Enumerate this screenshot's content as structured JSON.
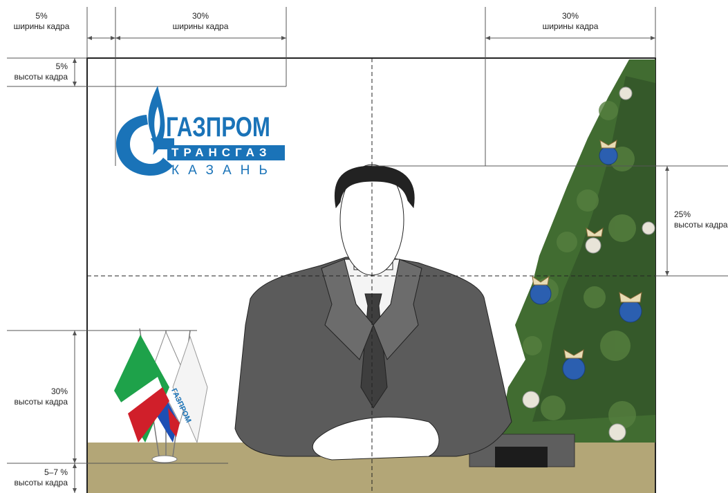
{
  "annotations": {
    "left_margin_width": [
      "5%",
      "ширины кадра"
    ],
    "logo_width": [
      "30%",
      "ширины кадра"
    ],
    "tree_width": [
      "30%",
      "ширины кадра"
    ],
    "top_margin_height": [
      "5%",
      "высоты кадра"
    ],
    "head_height": [
      "25%",
      "высоты кадра"
    ],
    "flags_height": [
      "30%",
      "высоты кадра"
    ],
    "table_height": [
      "5–7 %",
      "высоты кадра"
    ]
  },
  "logo": {
    "line1": "ГАЗПРОМ",
    "line2": "ТРАНСГАЗ",
    "line3": "КАЗАНЬ"
  },
  "flag_logo_text": "ГАЗПРОМ",
  "colors": {
    "brand_blue": "#1a73b8",
    "table": "#b3a677",
    "suit": "#5b5b5b",
    "tree": "#3f6a2f",
    "ornament": "#2b5fb0"
  }
}
